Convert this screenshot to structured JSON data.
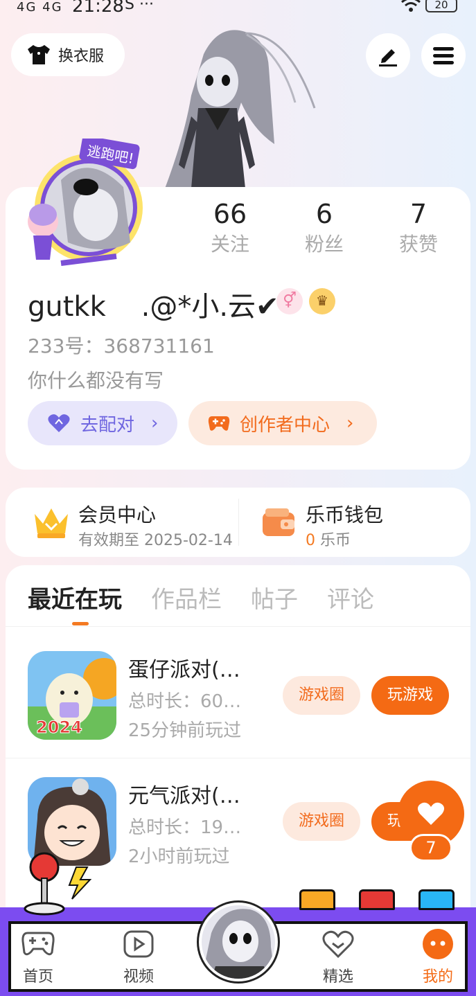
{
  "status_bar": {
    "signal": "4G 4G",
    "time": "21:28",
    "extra": "S ···",
    "battery": "20"
  },
  "header": {
    "outfit_label": "换衣服"
  },
  "stats": [
    {
      "value": "66",
      "label": "关注"
    },
    {
      "value": "6",
      "label": "粉丝"
    },
    {
      "value": "7",
      "label": "获赞"
    }
  ],
  "profile": {
    "username": "gutkk    .@*小.云✔",
    "uid": "233号：368731161",
    "bio": "你什么都没有写",
    "gender_symbol": "⚥",
    "crown_symbol": "♛"
  },
  "actions": {
    "pair_label": "去配对",
    "creator_label": "创作者中心",
    "chevron": "›"
  },
  "wallet": {
    "vip_title": "会员中心",
    "vip_sub": "有效期至 2025-02-14",
    "coin_title": "乐币钱包",
    "coin_num": "0",
    "coin_unit": " 乐币"
  },
  "tabs": [
    "最近在玩",
    "作品栏",
    "帖子",
    "评论"
  ],
  "games": [
    {
      "title": "蛋仔派对(…",
      "duration": "总时长：60…",
      "last_played": "25分钟前玩过",
      "circle": "游戏圈",
      "play": "玩游戏",
      "thumb_text": "2024"
    },
    {
      "title": "元气派对(…",
      "duration": "总时长：19…",
      "last_played": "2小时前玩过",
      "circle": "游戏圈",
      "play": "玩游戏"
    }
  ],
  "like_float": {
    "count": "7"
  },
  "nav": {
    "home": "首页",
    "video": "视频",
    "featured": "精选",
    "mine": "我的"
  },
  "colors": {
    "accent": "#f46a14",
    "purple": "#7c4cf0",
    "pair": "#6f66e0"
  }
}
